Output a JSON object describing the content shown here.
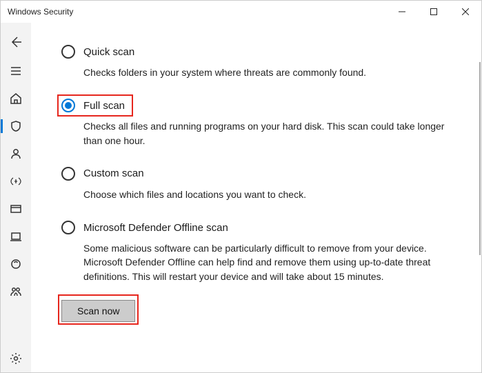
{
  "window": {
    "title": "Windows Security"
  },
  "options": {
    "quick": {
      "label": "Quick scan",
      "desc": "Checks folders in your system where threats are commonly found."
    },
    "full": {
      "label": "Full scan",
      "desc": "Checks all files and running programs on your hard disk. This scan could take longer than one hour."
    },
    "custom": {
      "label": "Custom scan",
      "desc": "Choose which files and locations you want to check."
    },
    "offline": {
      "label": "Microsoft Defender Offline scan",
      "desc": "Some malicious software can be particularly difficult to remove from your device. Microsoft Defender Offline can help find and remove them using up-to-date threat definitions. This will restart your device and will take about 15 minutes."
    }
  },
  "button": {
    "scan_now": "Scan now"
  },
  "selected": "full"
}
